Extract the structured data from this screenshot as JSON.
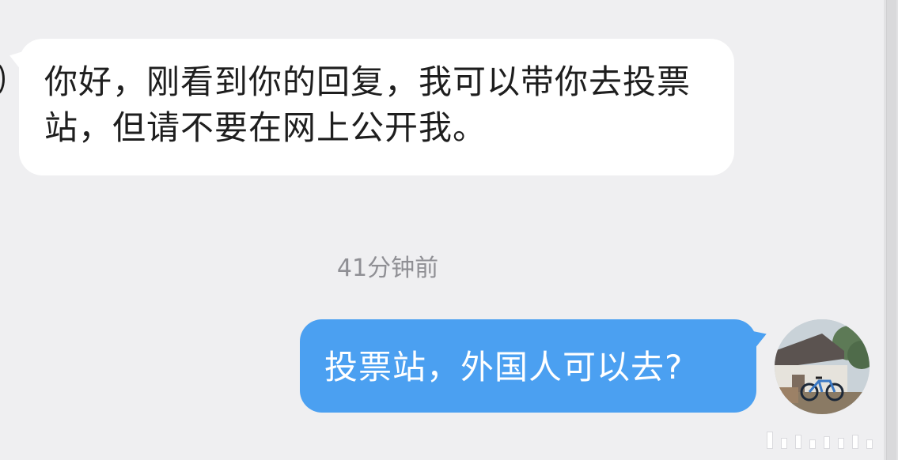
{
  "conversation": {
    "incoming_message": {
      "text": "你好，刚看到你的回复，我可以带你去投票站，但请不要在网上公开我。"
    },
    "timestamp": "41分钟前",
    "outgoing_message": {
      "text": "投票站，外国人可以去?"
    },
    "avatar": {
      "icon": "user-avatar-photo"
    }
  },
  "colors": {
    "background": "#efeff1",
    "incoming_bubble": "#ffffff",
    "outgoing_bubble": "#4ba0f1",
    "timestamp_text": "#8f8f94"
  }
}
